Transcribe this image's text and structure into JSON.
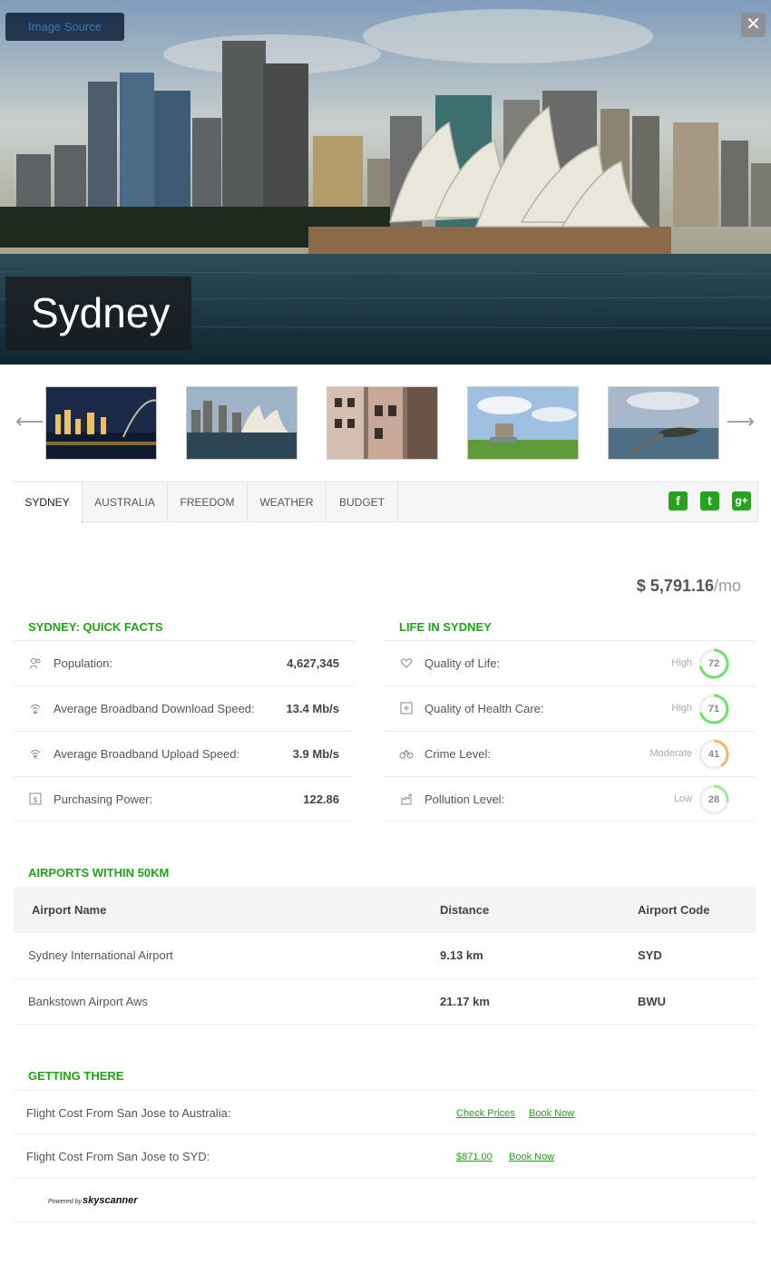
{
  "hero": {
    "image_source_label": "Image Source",
    "close_label": "✕",
    "city": "Sydney"
  },
  "thumbnails": {
    "prev_icon": "arrow-left-icon",
    "next_icon": "arrow-right-icon",
    "prev_glyph": "⟵",
    "next_glyph": "⟶"
  },
  "tabs": [
    {
      "label": "SYDNEY",
      "active": true
    },
    {
      "label": "AUSTRALIA",
      "active": false
    },
    {
      "label": "FREEDOM",
      "active": false
    },
    {
      "label": "WEATHER",
      "active": false
    },
    {
      "label": "BUDGET",
      "active": false
    }
  ],
  "social": {
    "facebook": "f",
    "twitter": "t",
    "google_plus": "g+"
  },
  "price": {
    "amount": "$ 5,791.16",
    "suffix": "/mo"
  },
  "quick_facts": {
    "title": "SYDNEY: QUICK FACTS",
    "rows": [
      {
        "label": "Population:",
        "value": "4,627,345",
        "icon": "population-icon"
      },
      {
        "label": "Average Broadband Download Speed:",
        "value": "13.4 Mb/s",
        "icon": "wifi-download-icon"
      },
      {
        "label": "Average Broadband Upload Speed:",
        "value": "3.9 Mb/s",
        "icon": "wifi-upload-icon"
      },
      {
        "label": "Purchasing Power:",
        "value": "122.86",
        "icon": "dollar-icon"
      }
    ]
  },
  "life": {
    "title": "LIFE IN SYDNEY",
    "rows": [
      {
        "label": "Quality of Life:",
        "level": "High",
        "score": "72",
        "pct": 0.72,
        "color": "#6fe06a",
        "icon": "heart-icon"
      },
      {
        "label": "Quality of Health Care:",
        "level": "High",
        "score": "71",
        "pct": 0.71,
        "color": "#6fe06a",
        "icon": "health-icon"
      },
      {
        "label": "Crime Level:",
        "level": "Moderate",
        "score": "41",
        "pct": 0.41,
        "color": "#f3b56b",
        "icon": "bike-icon"
      },
      {
        "label": "Pollution Level:",
        "level": "Low",
        "score": "28",
        "pct": 0.28,
        "color": "#9fe89a",
        "icon": "factory-icon"
      }
    ]
  },
  "airports": {
    "title": "AIRPORTS WITHIN 50KM",
    "headers": [
      "Airport Name",
      "Distance",
      "Airport Code"
    ],
    "rows": [
      {
        "name": "Sydney International Airport",
        "distance": "9.13 km",
        "code": "SYD"
      },
      {
        "name": "Bankstown Airport Aws",
        "distance": "21.17 km",
        "code": "BWU"
      }
    ]
  },
  "getting_there": {
    "title": "GETTING THERE",
    "rows": [
      {
        "label": "Flight Cost From San Jose to Australia:",
        "link1": "Check Prices",
        "link2": "Book Now"
      },
      {
        "label": "Flight Cost From San Jose to SYD:",
        "link1": "$871.00",
        "link2": "Book Now"
      }
    ],
    "powered_by": "Powered by",
    "provider": "skyscanner"
  },
  "colors": {
    "accent": "#21a41a"
  }
}
